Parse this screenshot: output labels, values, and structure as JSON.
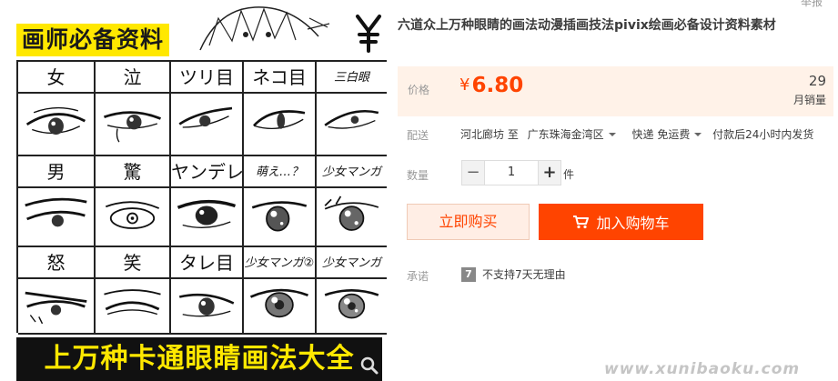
{
  "product_image": {
    "title_text": "画师必备资料",
    "banner_text": "上万种卡通眼睛画法大全",
    "grid_rows": [
      [
        "女",
        "泣",
        "ツリ目",
        "ネコ目",
        "三白眼"
      ],
      [
        "男",
        "驚",
        "ヤンデレ",
        "萌え…？",
        "少女マンガ"
      ],
      [
        "怒",
        "笑",
        "タレ目",
        "少女マンガ②",
        "少女マンガ"
      ]
    ]
  },
  "top_partial_text": "举报",
  "product": {
    "title": "六道众上万种眼睛的画法动漫插画技法pivix绘画必备设计资料素材"
  },
  "price": {
    "label": "价格",
    "currency": "¥",
    "value": "6.80",
    "sales_count": "29",
    "sales_label": "月销量",
    "accent_color": "#ff4400"
  },
  "shipping": {
    "label": "配送",
    "from": "河北廊坊 至",
    "to": "广东珠海金湾区",
    "method": "快递 免运费",
    "note": "付款后24小时内发货"
  },
  "quantity": {
    "label": "数量",
    "value": "1",
    "minus": "−",
    "plus": "+",
    "unit": "件"
  },
  "actions": {
    "buy_now": "立即购买",
    "add_to_cart": "加入购物车"
  },
  "promise": {
    "label": "承诺",
    "icon_text": "7",
    "text": "不支持7天无理由"
  },
  "watermark": "www.xunibaoku.com"
}
